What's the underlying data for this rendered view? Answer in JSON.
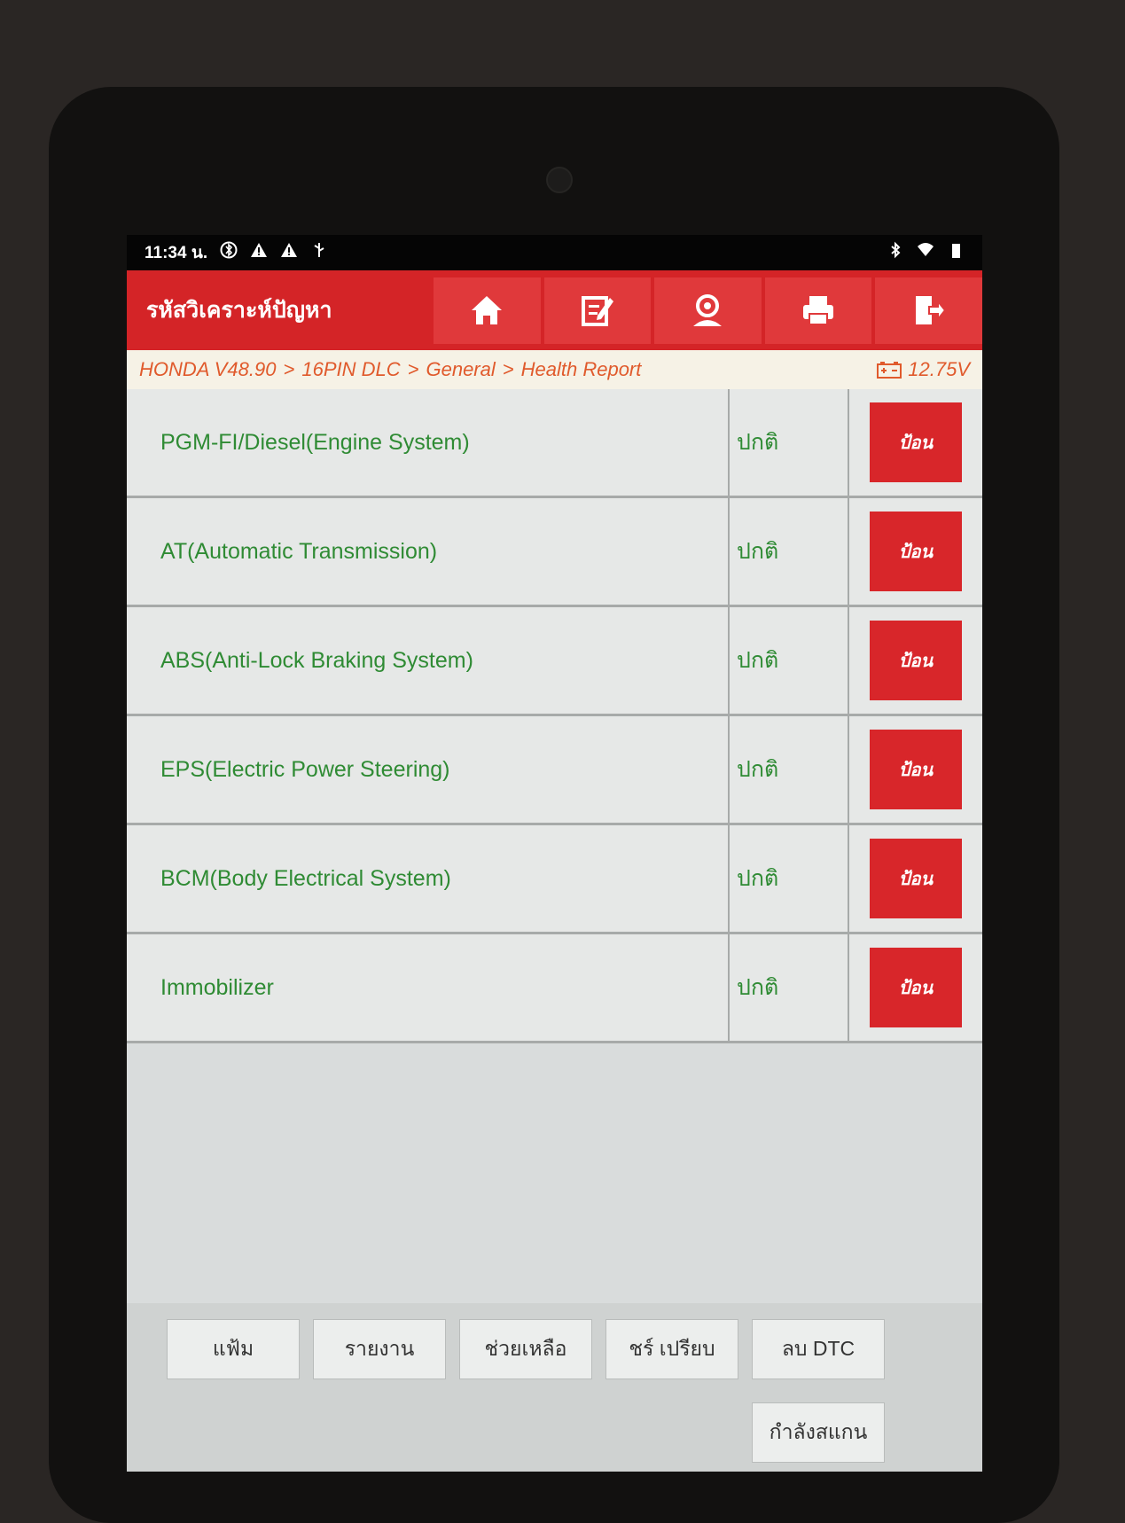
{
  "status_bar": {
    "time": "11:34 น.",
    "battery_percent": 90
  },
  "header": {
    "title": "รหัสวิเคราะห์ปัญหา",
    "toolbar_icons": [
      "home-icon",
      "edit-icon",
      "user-icon",
      "print-icon",
      "exit-icon"
    ]
  },
  "breadcrumb": {
    "items": [
      "HONDA V48.90",
      "16PIN DLC",
      "General",
      "Health Report"
    ],
    "separator": ">",
    "voltage": "12.75V"
  },
  "systems": [
    {
      "name": "PGM-FI/Diesel(Engine System)",
      "status": "ปกติ",
      "action": "ป้อน"
    },
    {
      "name": "AT(Automatic Transmission)",
      "status": "ปกติ",
      "action": "ป้อน"
    },
    {
      "name": "ABS(Anti-Lock Braking System)",
      "status": "ปกติ",
      "action": "ป้อน"
    },
    {
      "name": "EPS(Electric Power Steering)",
      "status": "ปกติ",
      "action": "ป้อน"
    },
    {
      "name": "BCM(Body Electrical System)",
      "status": "ปกติ",
      "action": "ป้อน"
    },
    {
      "name": "Immobilizer",
      "status": "ปกติ",
      "action": "ป้อน"
    }
  ],
  "bottom_buttons": {
    "file": "แฟ้ม",
    "report": "รายงาน",
    "help": "ช่วยเหลือ",
    "compare": "ชร์ เปรียบ",
    "clear_dtc": "ลบ DTC",
    "scanning": "กำลังสแกน"
  },
  "colors": {
    "header_red": "#d42427",
    "enter_button": "#d8262a",
    "ok_text": "#2f8b34",
    "breadcrumb_text": "#e05a2c"
  }
}
